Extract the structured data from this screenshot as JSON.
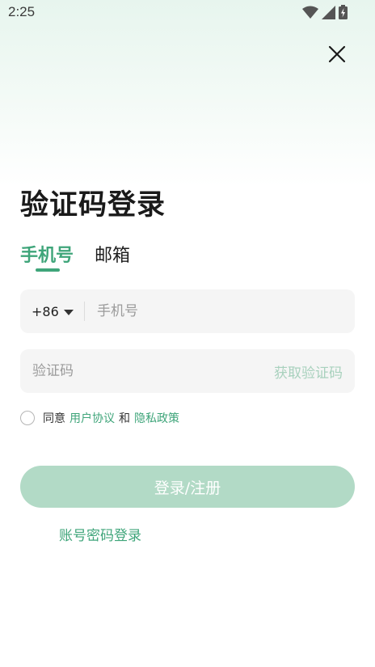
{
  "status_bar": {
    "time": "2:25",
    "icons": [
      "wifi-icon",
      "cellular-signal-icon",
      "battery-charging-icon"
    ]
  },
  "header": {
    "close_icon": "close-icon"
  },
  "page": {
    "title": "验证码登录"
  },
  "tabs": [
    {
      "label": "手机号",
      "active": true
    },
    {
      "label": "邮箱",
      "active": false
    }
  ],
  "phone_field": {
    "country_code": "+86",
    "value": "",
    "placeholder": "手机号"
  },
  "code_field": {
    "value": "",
    "placeholder": "验证码",
    "get_code_label": "获取验证码"
  },
  "agreement": {
    "checked": false,
    "prefix": "同意",
    "user_agreement": "用户协议",
    "conjunction": "和",
    "privacy_policy": "隐私政策"
  },
  "actions": {
    "login_label": "登录/注册",
    "password_login_label": "账号密码登录"
  },
  "colors": {
    "accent": "#3fa57a",
    "button_disabled": "#b2dac6",
    "get_code_disabled": "#a8d1bd"
  }
}
